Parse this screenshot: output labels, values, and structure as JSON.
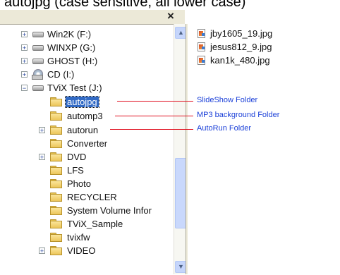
{
  "caption": "autojpg (case sensitive, all lower case)",
  "window": {
    "close_glyph": "×"
  },
  "scrollbar": {
    "up_glyph": "▲",
    "down_glyph": "▼"
  },
  "tree": {
    "items": [
      {
        "label": "Win2K (F:)",
        "icon": "drive-icon",
        "expander": "+"
      },
      {
        "label": "WINXP (G:)",
        "icon": "drive-icon",
        "expander": "+"
      },
      {
        "label": "GHOST (H:)",
        "icon": "drive-icon",
        "expander": "+"
      },
      {
        "label": "CD (I:)",
        "icon": "cd-drive-icon",
        "expander": "+"
      },
      {
        "label": "TViX Test (J:)",
        "icon": "drive-icon",
        "expander": "−"
      },
      {
        "label": "autojpg",
        "icon": "folder-icon",
        "expander": "",
        "selected": true
      },
      {
        "label": "automp3",
        "icon": "folder-icon",
        "expander": ""
      },
      {
        "label": "autorun",
        "icon": "folder-icon",
        "expander": "+"
      },
      {
        "label": "Converter",
        "icon": "folder-icon",
        "expander": ""
      },
      {
        "label": "DVD",
        "icon": "folder-icon",
        "expander": "+"
      },
      {
        "label": "LFS",
        "icon": "folder-icon",
        "expander": ""
      },
      {
        "label": "Photo",
        "icon": "folder-icon",
        "expander": ""
      },
      {
        "label": "RECYCLER",
        "icon": "folder-icon",
        "expander": ""
      },
      {
        "label": "System Volume Infor",
        "icon": "folder-icon",
        "expander": ""
      },
      {
        "label": "TViX_Sample",
        "icon": "folder-icon",
        "expander": ""
      },
      {
        "label": "tvixfw",
        "icon": "folder-icon",
        "expander": ""
      },
      {
        "label": "VIDEO",
        "icon": "folder-icon",
        "expander": "+"
      }
    ]
  },
  "files": [
    {
      "name": "jby1605_19.jpg",
      "icon": "jpg-file-icon"
    },
    {
      "name": "jesus812_9.jpg",
      "icon": "jpg-file-icon"
    },
    {
      "name": "kan1k_480.jpg",
      "icon": "jpg-file-icon"
    }
  ],
  "annotations": [
    {
      "text": "SlideShow Folder",
      "for": "autojpg"
    },
    {
      "text": "MP3 background Folder",
      "for": "automp3"
    },
    {
      "text": "AutoRun Folder",
      "for": "autorun"
    }
  ],
  "colors": {
    "selection": "#316ac5",
    "annotation_line": "#e01020",
    "annotation_text": "#1a3fd8"
  }
}
